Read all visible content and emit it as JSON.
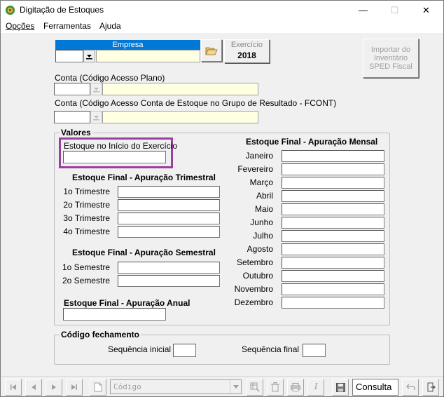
{
  "window": {
    "title": "Digitação de Estoques",
    "controls": {
      "minimize": "—",
      "maximize": "☐",
      "close": "✕"
    }
  },
  "menu": {
    "items": [
      {
        "label": "Opções",
        "accel": "O"
      },
      {
        "label": "Ferramentas",
        "accel": "F"
      },
      {
        "label": "Ajuda",
        "accel": "A"
      }
    ]
  },
  "empresa": {
    "header": "Empresa",
    "code_value": "",
    "name_value": "",
    "browse_icon": "folder-open-icon"
  },
  "exercicio": {
    "label": "Exercício",
    "value": "2018"
  },
  "sped_button": {
    "line1": "Importar do",
    "line2": "Inventário",
    "line3": "SPED Fiscal"
  },
  "conta": {
    "label": "Conta (Código Acesso Plano)",
    "code_value": "",
    "name_value": ""
  },
  "conta_fcont": {
    "label": "Conta (Código Acesso Conta de Estoque no Grupo de Resultado - FCONT)",
    "code_value": "",
    "name_value": ""
  },
  "valores": {
    "title": "Valores",
    "inicio_label": "Estoque no Início do Exercício",
    "inicio_value": "",
    "trimestral": {
      "title": "Estoque Final - Apuração Trimestral",
      "rows": [
        "1o Trimestre",
        "2o Trimestre",
        "3o Trimestre",
        "4o Trimestre"
      ]
    },
    "semestral": {
      "title": "Estoque Final - Apuração Semestral",
      "rows": [
        "1o Semestre",
        "2o Semestre"
      ]
    },
    "anual": {
      "title": "Estoque Final - Apuração Anual"
    },
    "mensal": {
      "title": "Estoque Final - Apuração Mensal",
      "rows": [
        "Janeiro",
        "Fevereiro",
        "Março",
        "Abril",
        "Maio",
        "Junho",
        "Julho",
        "Agosto",
        "Setembro",
        "Outubro",
        "Novembro",
        "Dezembro"
      ]
    }
  },
  "fechamento": {
    "title": "Código fechamento",
    "seq_inicial_label": "Sequência inicial",
    "seq_final_label": "Sequência final"
  },
  "toolbar": {
    "search_placeholder": "Código",
    "mode_label": "Consulta"
  },
  "colors": {
    "empresa_header": "#0078d7",
    "highlight_border": "#9b3fa0",
    "yellow_field": "#ffffe1"
  }
}
